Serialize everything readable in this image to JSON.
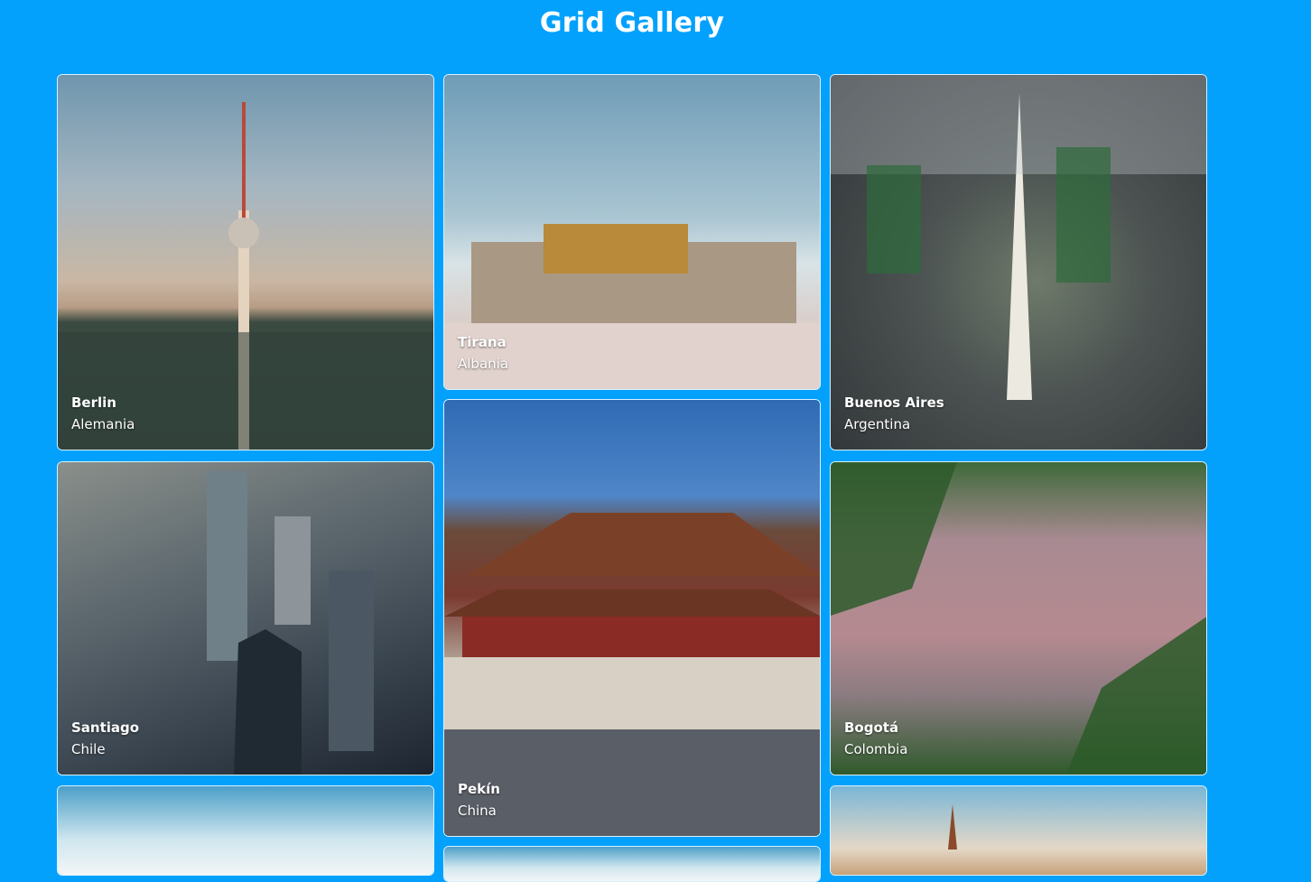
{
  "header": {
    "title": "Grid Gallery"
  },
  "gallery": [
    {
      "city": "Berlin",
      "country": "Alemania"
    },
    {
      "city": "Tirana",
      "country": "Albania"
    },
    {
      "city": "Buenos Aires",
      "country": "Argentina"
    },
    {
      "city": "Santiago",
      "country": "Chile"
    },
    {
      "city": "Pekín",
      "country": "China"
    },
    {
      "city": "Bogotá",
      "country": "Colombia"
    }
  ],
  "colors": {
    "background": "#03a1fc",
    "text": "#ffffff"
  }
}
